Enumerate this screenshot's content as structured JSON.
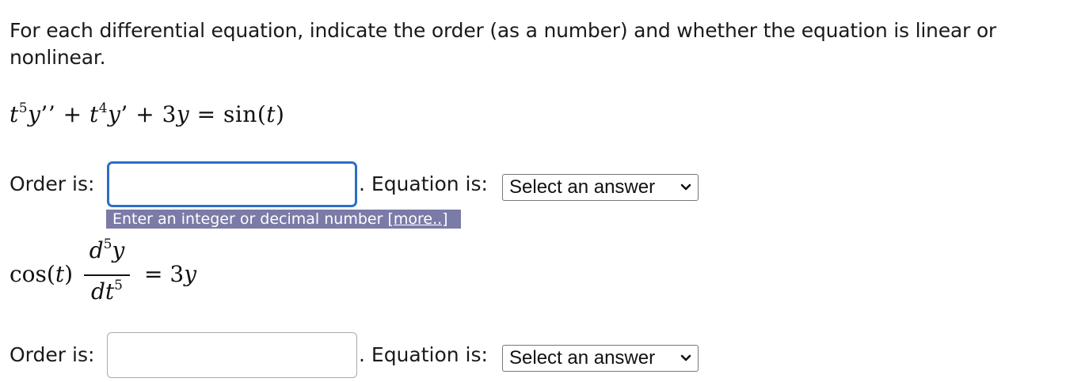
{
  "question": {
    "prompt": "For each differential equation, indicate the order (as a number) and whether the equation is linear or nonlinear."
  },
  "equation1": {
    "t1": "t",
    "e1": "5",
    "y1": "y",
    "p1": "’’ + ",
    "t2": "t",
    "e2": "4",
    "y2": "y",
    "p2": "’ + 3",
    "y3": "y",
    "p3": " = sin(",
    "t3": "t",
    "p4": ")"
  },
  "equation2": {
    "lhs_func": "cos(",
    "lhs_var": "t",
    "lhs_close": ")",
    "num_d": "d",
    "num_exp": "5",
    "num_y": "y",
    "den_dt": "dt",
    "den_exp": "5",
    "rhs_eq": "= 3",
    "rhs_y": "y"
  },
  "part1": {
    "order_label": "Order is:",
    "order_value": "",
    "equation_label": ". Equation is:",
    "select_value": "Select an answer",
    "hint_text": "Enter an integer or decimal number ",
    "hint_more": "[more..]"
  },
  "part2": {
    "order_label": "Order is:",
    "order_value": "",
    "equation_label": ". Equation is:",
    "select_value": "Select an answer"
  },
  "colors": {
    "focus_border": "#2d6ec6",
    "hint_background": "#7b7ba8"
  },
  "icons": {
    "dropdown": "chevron-down-icon"
  }
}
